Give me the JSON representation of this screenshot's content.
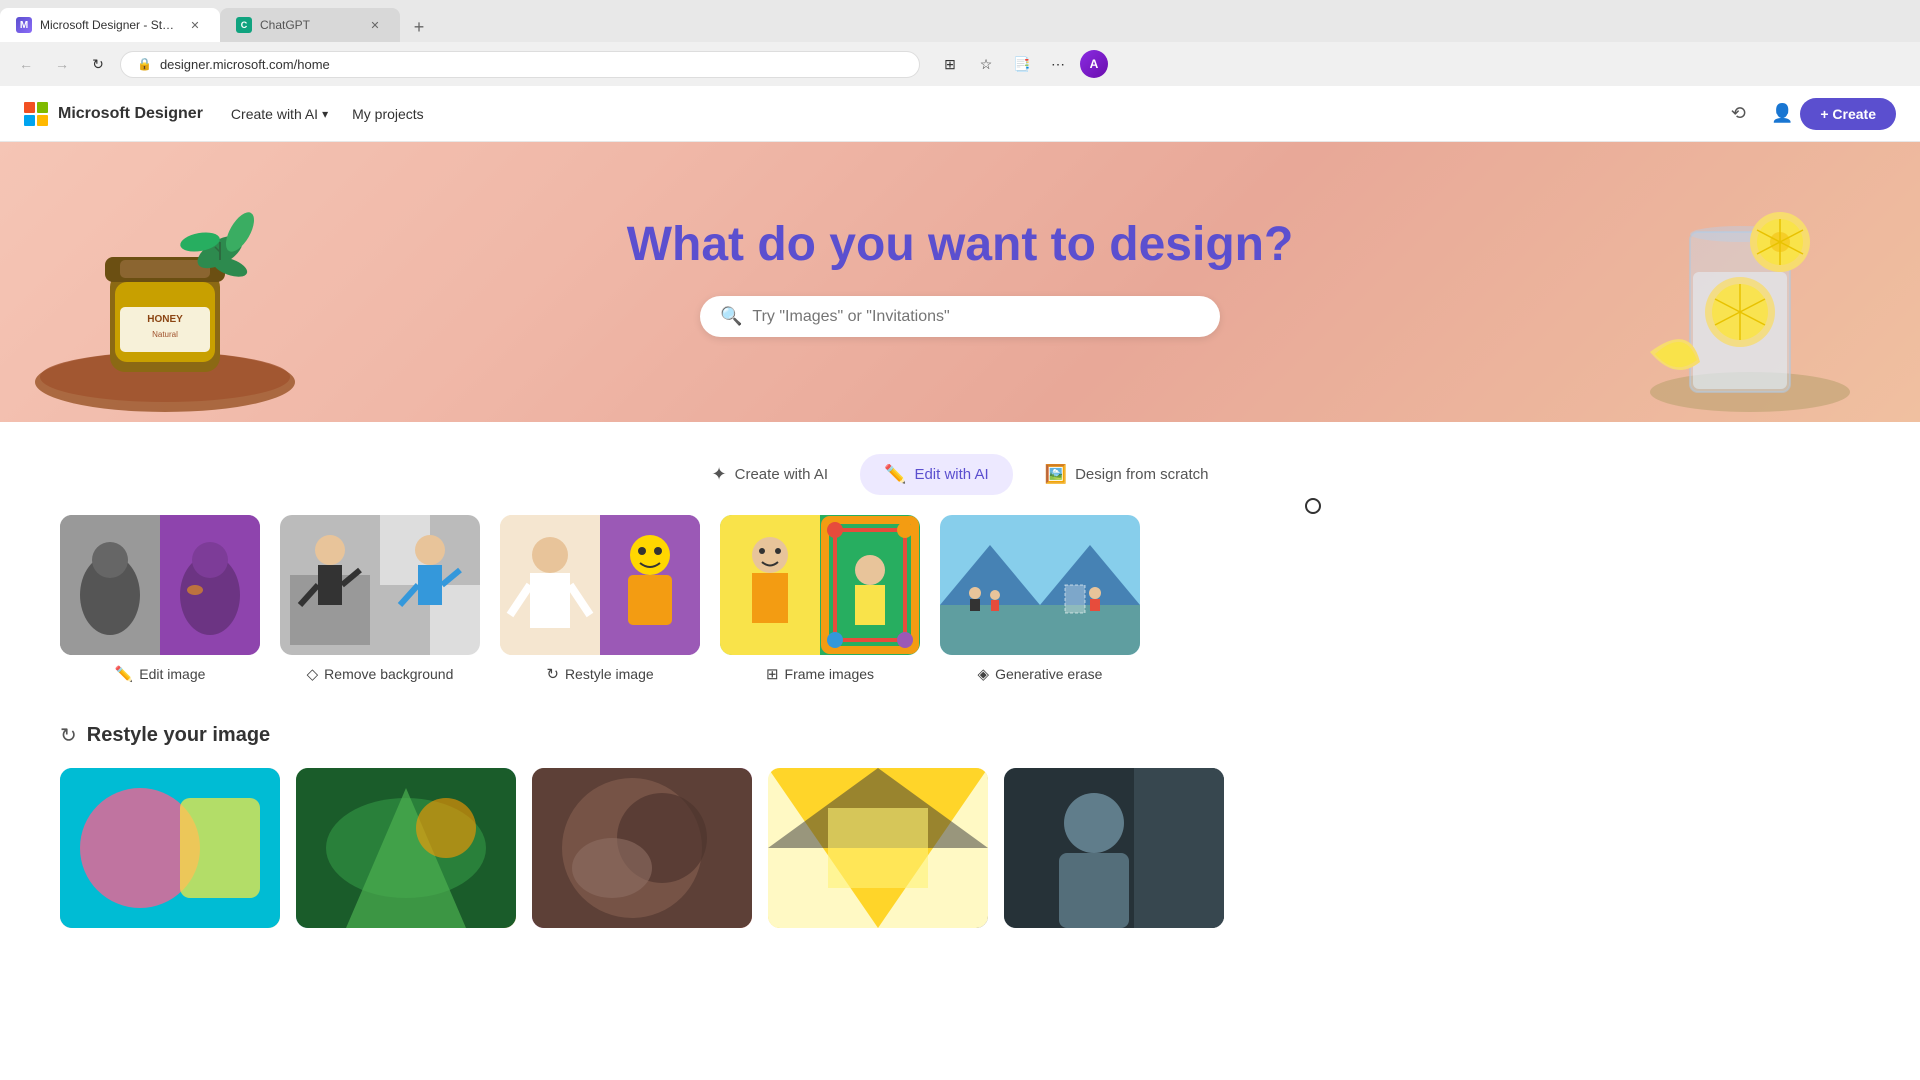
{
  "browser": {
    "tabs": [
      {
        "id": "tab1",
        "title": "Microsoft Designer - Stunning...",
        "active": true,
        "favicon_color": "#5b4fcf"
      },
      {
        "id": "tab2",
        "title": "ChatGPT",
        "active": false,
        "favicon_color": "#10a37f"
      }
    ],
    "new_tab_label": "+",
    "address": "designer.microsoft.com/home",
    "nav": {
      "back_icon": "←",
      "forward_icon": "→",
      "reload_icon": "↻",
      "lock_icon": "🔒"
    }
  },
  "header": {
    "brand_name": "Microsoft Designer",
    "nav_create_ai": "Create with AI",
    "nav_projects": "My projects",
    "create_button": "+ Create"
  },
  "hero": {
    "title": "What do you want to design?",
    "search_placeholder": "Try \"Images\" or \"Invitations\""
  },
  "tabs": [
    {
      "id": "create-ai",
      "label": "Create with AI",
      "icon": "✦",
      "active": false
    },
    {
      "id": "edit-ai",
      "label": "Edit with AI",
      "icon": "✏️",
      "active": true
    },
    {
      "id": "design-scratch",
      "label": "Design from scratch",
      "icon": "🖼️",
      "active": false
    }
  ],
  "cards": [
    {
      "id": "edit-image",
      "label": "Edit image",
      "icon": "✏️"
    },
    {
      "id": "remove-bg",
      "label": "Remove background",
      "icon": "◇"
    },
    {
      "id": "restyle-image",
      "label": "Restyle image",
      "icon": "↻"
    },
    {
      "id": "frame-images",
      "label": "Frame images",
      "icon": "⊞"
    },
    {
      "id": "generative-erase",
      "label": "Generative erase",
      "icon": "◈"
    }
  ],
  "restyle_section": {
    "icon": "↻",
    "title": "Restyle your image"
  },
  "colors": {
    "accent": "#5b4fcf",
    "hero_bg_start": "#f5c5b5",
    "hero_bg_end": "#e8a898",
    "active_tab_bg": "#ede9ff",
    "active_tab_text": "#5b4fcf"
  }
}
